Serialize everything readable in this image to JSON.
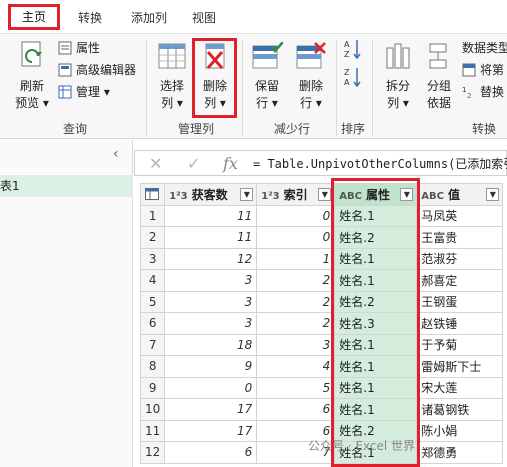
{
  "tabs": [
    {
      "label": "主页",
      "active": true
    },
    {
      "label": "转换",
      "active": false
    },
    {
      "label": "添加列",
      "active": false
    },
    {
      "label": "视图",
      "active": false
    }
  ],
  "ribbon": {
    "refresh_label_1": "刷新",
    "refresh_label_2": "预览",
    "properties_label": "属性",
    "advanced_editor_label": "高级编辑器",
    "manage_label": "管理",
    "query_group": "查询",
    "choose_col_label_1": "选择",
    "choose_col_label_2": "列",
    "delete_col_label_1": "删除",
    "delete_col_label_2": "列",
    "manage_cols_group": "管理列",
    "keep_rows_label_1": "保留",
    "keep_rows_label_2": "行",
    "remove_rows_label_1": "删除",
    "remove_rows_label_2": "行",
    "reduce_rows_group": "减少行",
    "sort_group": "排序",
    "split_col_label_1": "拆分",
    "split_col_label_2": "列",
    "group_by_label_1": "分组",
    "group_by_label_2": "依据",
    "data_type_label": "数据类型",
    "use_first_row_label": "将第",
    "replace_label": "替换",
    "transform_group": "转换"
  },
  "query_pane": {
    "item": "表1"
  },
  "formula_bar": {
    "fx": "fx",
    "text": "= Table.UnpivotOtherColumns(已添加索引,"
  },
  "table": {
    "columns": [
      {
        "type": "1²3",
        "name": "获客数"
      },
      {
        "type": "1²3",
        "name": "索引"
      },
      {
        "type": "ABC",
        "name": "属性"
      },
      {
        "type": "ABC",
        "name": "值"
      }
    ],
    "rows": [
      {
        "n": "1",
        "count": "11",
        "idx": "0",
        "attr": "姓名.1",
        "val": "马凤英"
      },
      {
        "n": "2",
        "count": "11",
        "idx": "0",
        "attr": "姓名.2",
        "val": "王富贵"
      },
      {
        "n": "3",
        "count": "12",
        "idx": "1",
        "attr": "姓名.1",
        "val": "范淑芬"
      },
      {
        "n": "4",
        "count": "3",
        "idx": "2",
        "attr": "姓名.1",
        "val": "郝喜定"
      },
      {
        "n": "5",
        "count": "3",
        "idx": "2",
        "attr": "姓名.2",
        "val": "王钢蛋"
      },
      {
        "n": "6",
        "count": "3",
        "idx": "2",
        "attr": "姓名.3",
        "val": "赵铁锤"
      },
      {
        "n": "7",
        "count": "18",
        "idx": "3",
        "attr": "姓名.1",
        "val": "于予菊"
      },
      {
        "n": "8",
        "count": "9",
        "idx": "4",
        "attr": "姓名.1",
        "val": "雷姆斯下士"
      },
      {
        "n": "9",
        "count": "0",
        "idx": "5",
        "attr": "姓名.1",
        "val": "宋大莲"
      },
      {
        "n": "10",
        "count": "17",
        "idx": "6",
        "attr": "姓名.1",
        "val": "诸葛钢铁"
      },
      {
        "n": "11",
        "count": "17",
        "idx": "6",
        "attr": "姓名.2",
        "val": "陈小娟"
      },
      {
        "n": "12",
        "count": "6",
        "idx": "7",
        "attr": "姓名.1",
        "val": "郑德勇"
      }
    ]
  },
  "watermark": "公众号 · Excel 世界"
}
